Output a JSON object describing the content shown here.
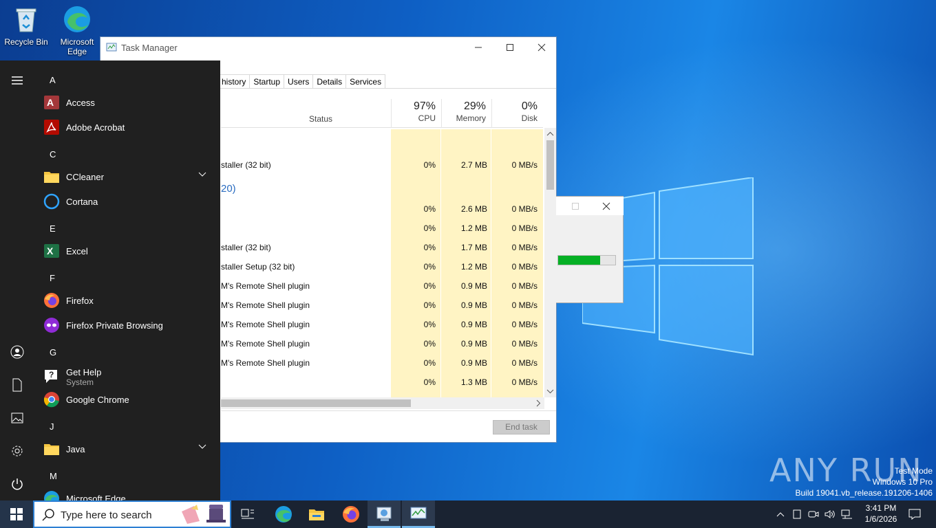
{
  "desktop": {
    "icons": [
      {
        "label": "Recycle Bin"
      },
      {
        "label": "Microsoft Edge"
      }
    ],
    "watermark": {
      "line1": "Test Mode",
      "line2": "Windows 10 Pro",
      "line3": "Build 19041.vb_release.191206-1406"
    },
    "brand": "ANY RUN"
  },
  "task_manager": {
    "title": "Task Manager",
    "tabs": [
      "history",
      "Startup",
      "Users",
      "Details",
      "Services"
    ],
    "columns": {
      "status": "Status",
      "cpu": {
        "pct": "97%",
        "label": "CPU"
      },
      "memory": {
        "pct": "29%",
        "label": "Memory"
      },
      "disk": {
        "pct": "0%",
        "label": "Disk"
      }
    },
    "group_label": "20)",
    "rows": [
      {
        "name": "",
        "cpu": "",
        "mem": "",
        "disk": ""
      },
      {
        "name": "staller (32 bit)",
        "cpu": "0%",
        "mem": "2.7 MB",
        "disk": "0 MB/s"
      },
      {
        "name": "",
        "cpu": "0%",
        "mem": "2.6 MB",
        "disk": "0 MB/s"
      },
      {
        "name": "",
        "cpu": "0%",
        "mem": "1.2 MB",
        "disk": "0 MB/s"
      },
      {
        "name": "staller (32 bit)",
        "cpu": "0%",
        "mem": "1.7 MB",
        "disk": "0 MB/s"
      },
      {
        "name": "staller Setup (32 bit)",
        "cpu": "0%",
        "mem": "1.2 MB",
        "disk": "0 MB/s"
      },
      {
        "name": "M's Remote Shell plugin",
        "cpu": "0%",
        "mem": "0.9 MB",
        "disk": "0 MB/s"
      },
      {
        "name": "M's Remote Shell plugin",
        "cpu": "0%",
        "mem": "0.9 MB",
        "disk": "0 MB/s"
      },
      {
        "name": "M's Remote Shell plugin",
        "cpu": "0%",
        "mem": "0.9 MB",
        "disk": "0 MB/s"
      },
      {
        "name": "M's Remote Shell plugin",
        "cpu": "0%",
        "mem": "0.9 MB",
        "disk": "0 MB/s"
      },
      {
        "name": "M's Remote Shell plugin",
        "cpu": "0%",
        "mem": "0.9 MB",
        "disk": "0 MB/s"
      },
      {
        "name": "",
        "cpu": "0%",
        "mem": "1.3 MB",
        "disk": "0 MB/s"
      }
    ],
    "end_task": "End task"
  },
  "installer_dialog": {
    "progress": 0.74
  },
  "start_menu": {
    "letters": [
      "A",
      "C",
      "E",
      "F",
      "G",
      "J",
      "M"
    ],
    "apps": [
      {
        "label": "Access",
        "icon": "access-icon"
      },
      {
        "label": "Adobe Acrobat",
        "icon": "acrobat-icon"
      },
      {
        "label": "CCleaner",
        "icon": "folder-icon"
      },
      {
        "label": "Cortana",
        "icon": "cortana-icon"
      },
      {
        "label": "Excel",
        "icon": "excel-icon"
      },
      {
        "label": "Firefox",
        "icon": "firefox-icon"
      },
      {
        "label": "Firefox Private Browsing",
        "icon": "firefox-private-icon"
      },
      {
        "label": "Get Help",
        "sub": "System",
        "icon": "get-help-icon"
      },
      {
        "label": "Google Chrome",
        "icon": "chrome-icon"
      },
      {
        "label": "Java",
        "icon": "folder-icon"
      },
      {
        "label": "Microsoft Edge",
        "icon": "edge-icon"
      }
    ]
  },
  "taskbar": {
    "search_placeholder": "Type here to search",
    "clock_time": "3:41 PM",
    "clock_date": "1/6/2026"
  },
  "colors": {
    "accent": "#2d7fd3",
    "progress_fill": "#06b025",
    "column_highlight": "#fff4c4",
    "start_bg": "#202020"
  }
}
